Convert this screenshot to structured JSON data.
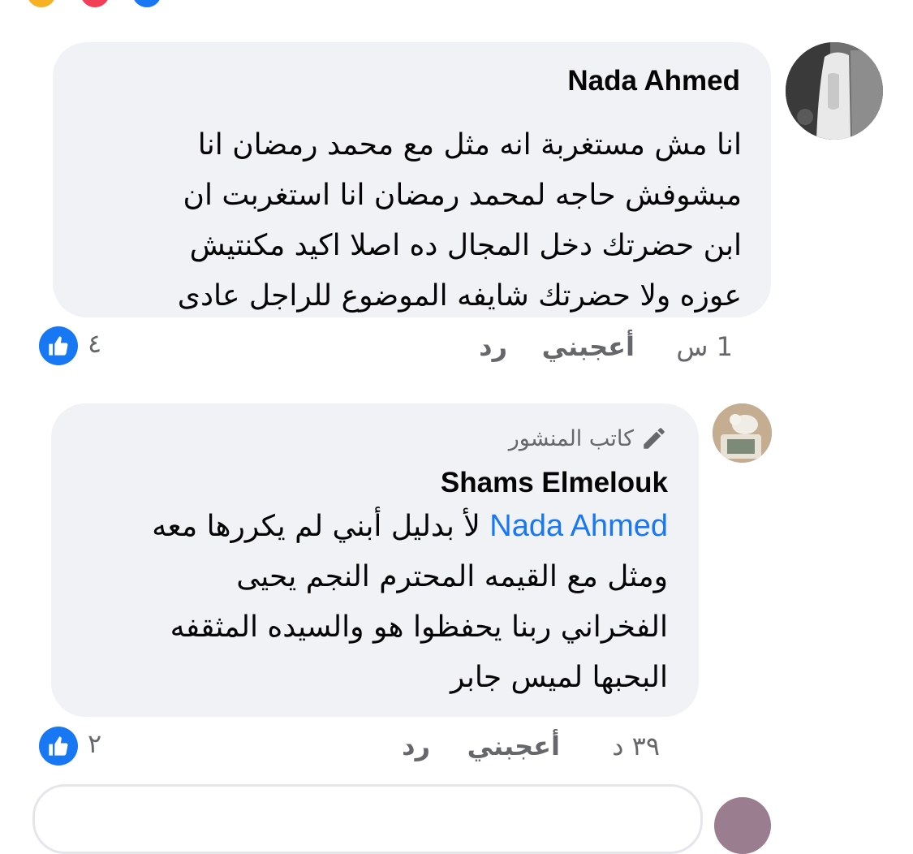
{
  "comments": [
    {
      "author": "Nada Ahmed",
      "text_lines": [
        "انا مش مستغربة انه مثل  مع محمد رمضان انا",
        "مبشوفش حاجه لمحمد رمضان انا استغربت ان",
        "ابن حضرتك دخل المجال ده اصلا اكيد مكنتيش",
        "عوزه ولا حضرتك شايفه الموضوع للراجل عادى"
      ],
      "time": "1 س",
      "like_label": "أعجبني",
      "reply_label": "رد",
      "reaction_count": "٤"
    },
    {
      "badge": "كاتب المنشور",
      "author": "Shams Elmelouk",
      "mention": "Nada Ahmed",
      "text_first": "لأ بدليل أبني لم يكررها معه",
      "text_lines": [
        "ومثل مع القيمه المحترم النجم يحيى",
        "الفخراني ربنا يحفظوا هو والسيده المثقفه",
        "البحبها لميس جابر"
      ],
      "time": "٣٩ د",
      "like_label": "أعجبني",
      "reply_label": "رد",
      "reaction_count": "٢"
    }
  ],
  "colors": {
    "bubble_bg": "#f0f2f5",
    "meta_text": "#65676b",
    "link_blue": "#1877f2",
    "like_blue": "#1877f2"
  },
  "icons": [
    "like-icon",
    "pencil-icon",
    "love-reaction-icon",
    "haha-reaction-icon"
  ]
}
